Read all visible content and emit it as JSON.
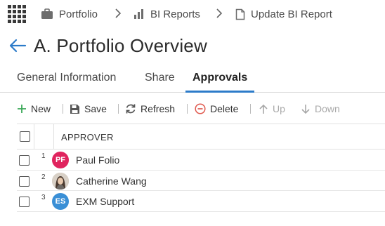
{
  "breadcrumb": {
    "items": [
      {
        "label": "Portfolio",
        "icon": "briefcase-icon"
      },
      {
        "label": "BI Reports",
        "icon": "bar-chart-icon"
      },
      {
        "label": "Update BI Report",
        "icon": "document-icon"
      }
    ]
  },
  "page": {
    "title": "A. Portfolio Overview"
  },
  "tabs": [
    {
      "label": "General Information",
      "active": false
    },
    {
      "label": "Share",
      "active": false
    },
    {
      "label": "Approvals",
      "active": true
    }
  ],
  "toolbar": {
    "new_label": "New",
    "save_label": "Save",
    "refresh_label": "Refresh",
    "delete_label": "Delete",
    "up_label": "Up",
    "down_label": "Down"
  },
  "grid": {
    "column_header": "APPROVER",
    "rows": [
      {
        "index": "1",
        "initials": "PF",
        "name": "Paul Folio",
        "avatar_color": "#e0245e"
      },
      {
        "index": "2",
        "initials": "",
        "name": "Catherine Wang",
        "avatar_color": "#8a7a6e"
      },
      {
        "index": "3",
        "initials": "ES",
        "name": "EXM Support",
        "avatar_color": "#3a8fd6"
      }
    ]
  },
  "colors": {
    "accent": "#2c7bc9",
    "new_icon": "#3aa757",
    "delete_icon": "#e05a4f"
  }
}
